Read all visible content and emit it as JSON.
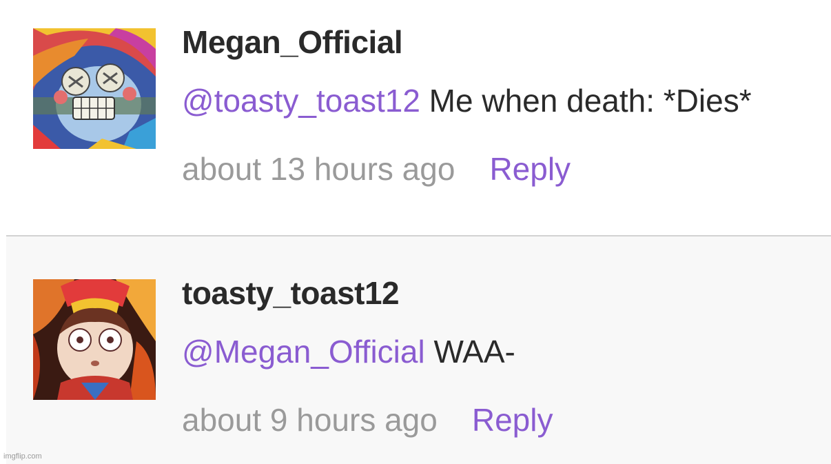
{
  "comments": [
    {
      "username": "Megan_Official",
      "mention": "@toasty_toast12",
      "text": " Me when death: *Dies*",
      "timestamp": "about 13 hours ago",
      "reply_label": "Reply",
      "avatar_icon": "jester-avatar-icon"
    },
    {
      "username": "toasty_toast12",
      "mention": "@Megan_Official",
      "text": " WAA-",
      "timestamp": "about 9 hours ago",
      "reply_label": "Reply",
      "avatar_icon": "jester-fire-avatar-icon"
    }
  ],
  "watermark": "imgflip.com",
  "colors": {
    "mention": "#8a5cd1",
    "timestamp": "#9a9a9a",
    "username": "#2a2a2a",
    "divider": "#d2d2d2",
    "second_bg": "#f8f8f8"
  }
}
